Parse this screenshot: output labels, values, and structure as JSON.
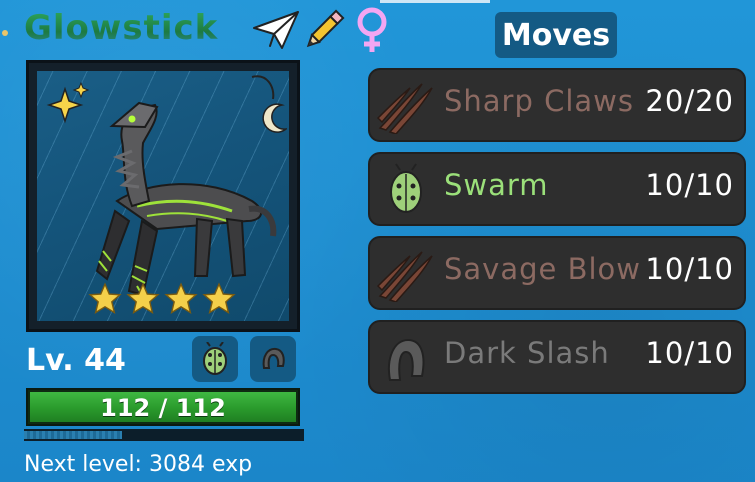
{
  "creature": {
    "name": "Glowstick",
    "gender": "female",
    "rarity_stars": 4,
    "level_label": "Lv. 44",
    "types": [
      "bug-icon",
      "dark-claw-icon"
    ],
    "hp_text": "112 / 112",
    "hp_current": 112,
    "hp_max": 112,
    "xp_progress": 0.35,
    "next_level_text": "Next level: 3084 exp"
  },
  "header_icons": [
    "paper-plane-icon",
    "pencil-icon",
    "female-symbol-icon"
  ],
  "moves_title": "Moves",
  "moves": [
    {
      "name": "Sharp Claws",
      "pp": "20/20",
      "color": "#8c6a62",
      "icon": "claw-marks-icon"
    },
    {
      "name": "Swarm",
      "pp": "10/10",
      "color": "#9be07a",
      "icon": "bug-icon"
    },
    {
      "name": "Savage Blow",
      "pp": "10/10",
      "color": "#8c6a62",
      "icon": "claw-marks-icon"
    },
    {
      "name": "Dark Slash",
      "pp": "10/10",
      "color": "#7a7a7a",
      "icon": "dark-slash-icon"
    }
  ],
  "colors": {
    "background": "#1e8bd0",
    "name_green": "#2faa5c",
    "hp_green": "#2a9a2c",
    "panel_blue": "#145a84",
    "move_bg": "#2e2e2e"
  }
}
